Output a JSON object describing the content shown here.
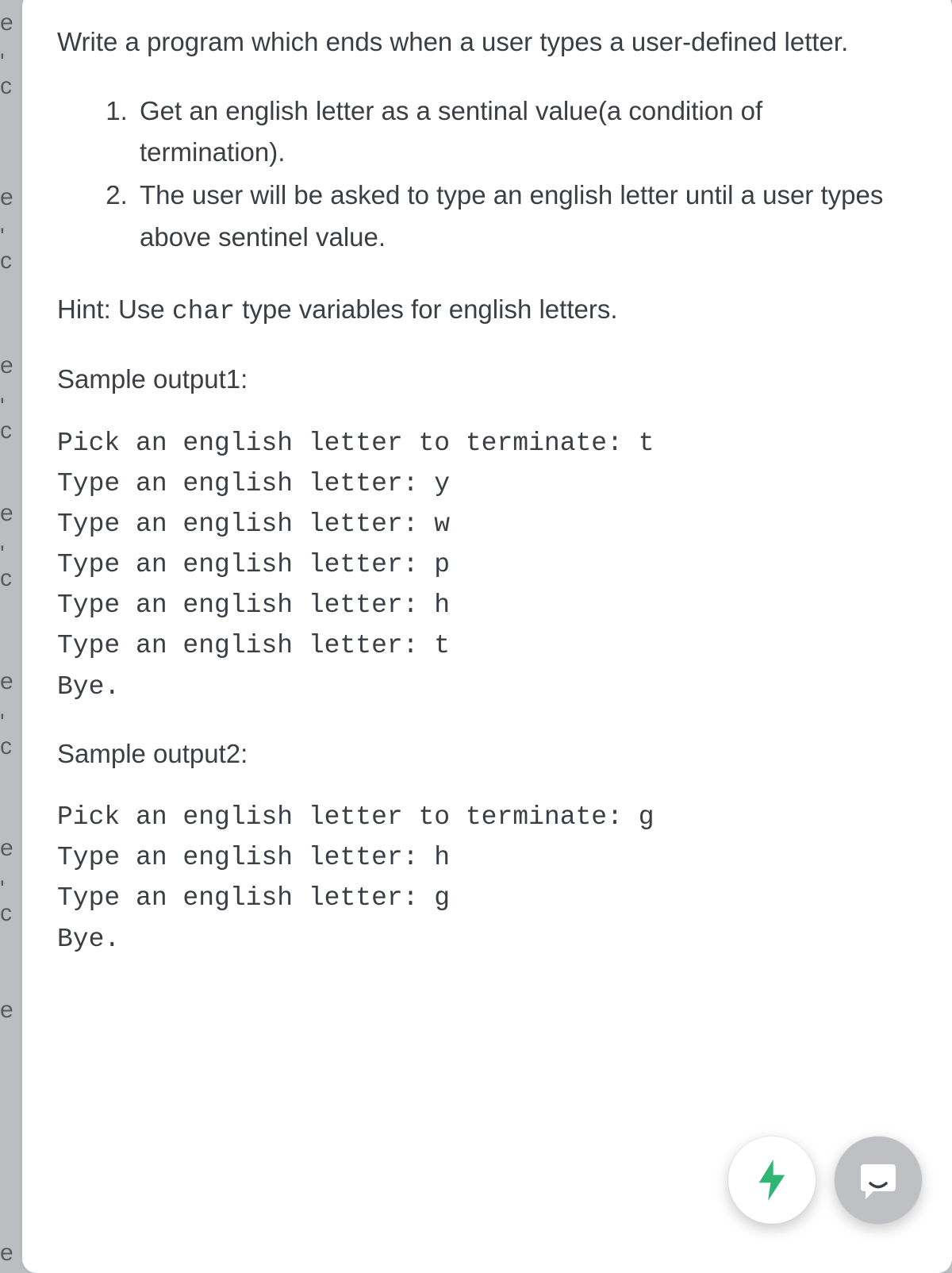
{
  "left_strip": {
    "e": "e",
    "c": "' c"
  },
  "intro": "Write a program which ends when a user types a user-defined letter.",
  "steps": [
    "Get an english letter as a sentinal value(a condition of termination).",
    "The user will be asked to type an english letter until a user types above sentinel value."
  ],
  "hint_prefix": "Hint: Use ",
  "hint_code": "char",
  "hint_suffix": " type variables for english letters.",
  "sample1_label": "Sample output1:",
  "sample1_code": "Pick an english letter to terminate: t\nType an english letter: y\nType an english letter: w\nType an english letter: p\nType an english letter: h\nType an english letter: t\nBye.",
  "sample2_label": "Sample output2:",
  "sample2_code": "Pick an english letter to terminate: g\nType an english letter: h\nType an english letter: g\nBye."
}
